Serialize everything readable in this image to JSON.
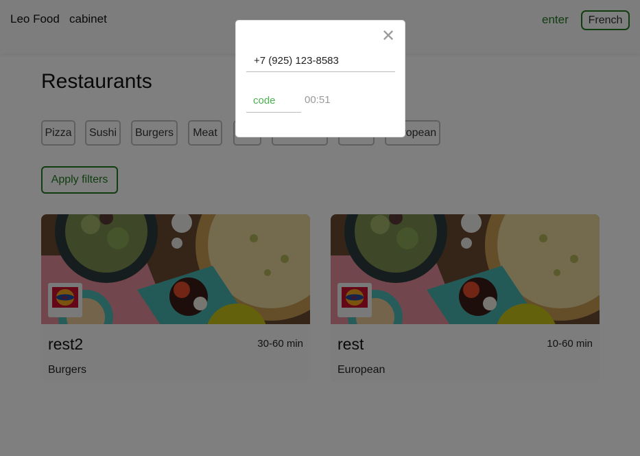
{
  "header": {
    "brand": "Leo Food",
    "cabinet": "cabinet",
    "enter": "enter",
    "language": "French"
  },
  "main": {
    "title": "Restaurants",
    "filters": [
      "Pizza",
      "Sushi",
      "Burgers",
      "Meat",
      "",
      "",
      "",
      "European"
    ],
    "apply_label": "Apply filters"
  },
  "restaurants": [
    {
      "name": "rest2",
      "time": "30-60 min",
      "cuisine": "Burgers",
      "logo": "burger-king-logo"
    },
    {
      "name": "rest",
      "time": "10-60 min",
      "cuisine": "European",
      "logo": "burger-king-logo"
    }
  ],
  "modal": {
    "close_icon": "close-icon",
    "phone_value": "+7 (925) 123-8583",
    "code_placeholder": "code",
    "timer": "00:51"
  },
  "colors": {
    "accent": "#1e7a1e",
    "code_placeholder": "#4caf50",
    "overlay": "rgba(0,0,0,0.5)"
  }
}
